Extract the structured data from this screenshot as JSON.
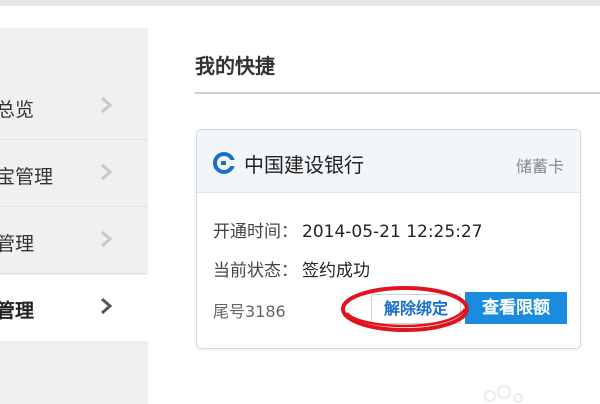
{
  "sidebar": {
    "items": [
      {
        "label": "总览"
      },
      {
        "label": "宝管理"
      },
      {
        "label": "管理"
      },
      {
        "label": "管理"
      }
    ]
  },
  "main": {
    "section_title": "我的快捷"
  },
  "card": {
    "bank_name": "中国建设银行",
    "card_type": "储蓄卡",
    "open_time_label": "开通时间：",
    "open_time_value": "2014-05-21 12:25:27",
    "status_label": "当前状态：",
    "status_value": "签约成功",
    "tail_number": "尾号3186",
    "unbind_label": "解除绑定",
    "limit_label": "查看限额"
  },
  "colors": {
    "accent": "#1a8ce0",
    "link": "#1a6fc9",
    "annotation": "#e0141e",
    "bank_logo": "#1b6fc2"
  }
}
